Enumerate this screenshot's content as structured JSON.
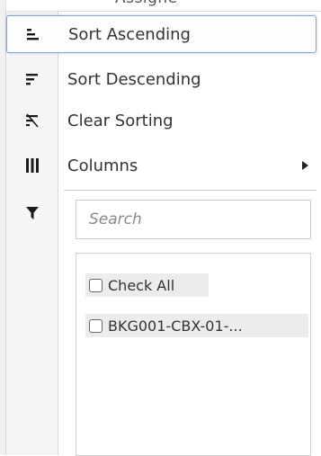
{
  "background_header_text": "Assigne",
  "menu": {
    "items": [
      {
        "label": "Sort Ascending",
        "icon": "sort-ascending-icon"
      },
      {
        "label": "Sort Descending",
        "icon": "sort-descending-icon"
      },
      {
        "label": "Clear Sorting",
        "icon": "clear-sorting-icon"
      },
      {
        "label": "Columns",
        "icon": "columns-icon"
      }
    ],
    "filter_icon": "filter-icon"
  },
  "filter": {
    "search_placeholder": "Search",
    "check_all_label": "Check All",
    "options": [
      {
        "label": "BKG001-CBX-01-..."
      }
    ]
  },
  "colors": {
    "highlight_border": "#85a4d6",
    "icon_column_bg": "#f5f5f5",
    "text": "#333333"
  }
}
